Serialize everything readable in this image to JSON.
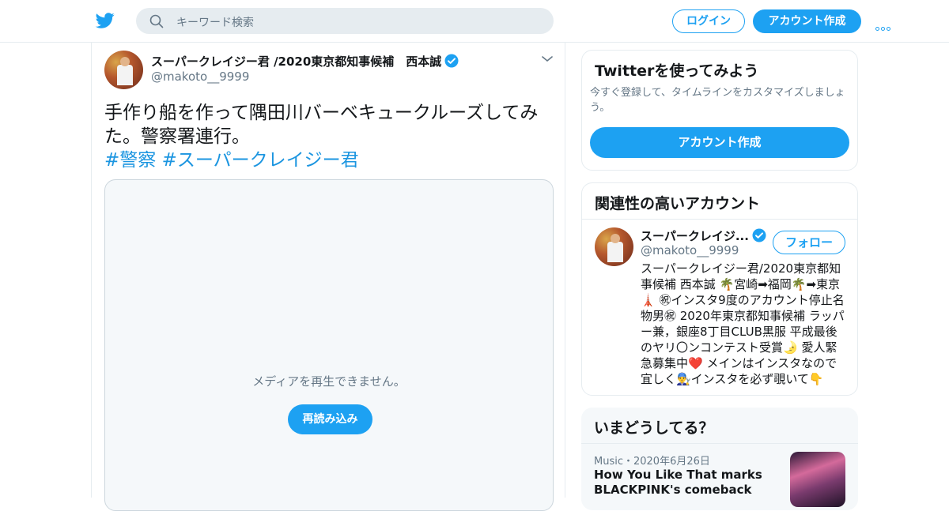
{
  "header": {
    "search_placeholder": "キーワード検索",
    "login_label": "ログイン",
    "signup_label": "アカウント作成"
  },
  "tweet": {
    "author_name": "スーパークレイジー君 /2020東京都知事候補　西本誠",
    "handle": "@makoto__9999",
    "text": "手作り船を作って隅田川バーベキュークルーズしてみた。警察署連行。",
    "hashtags": "#警察 #スーパークレイジー君",
    "media_message": "メディアを再生できません。",
    "reload_label": "再読み込み"
  },
  "signup_card": {
    "title": "Twitterを使ってみよう",
    "description": "今すぐ登録して、タイムラインをカスタマイズしましょう。",
    "button_label": "アカウント作成"
  },
  "related": {
    "title": "関連性の高いアカウント",
    "account_name": "スーパークレイジ...",
    "handle": "@makoto__9999",
    "follow_label": "フォロー",
    "bio": "スーパークレイジー君/2020東京都知事候補 西本誠 🌴宮崎➡福岡🌴➡東京🗼 ㊗インスタ9度のアカウント停止名物男㊗ 2020年東京都知事候補 ラッパー兼，銀座8丁目CLUB黒服 平成最後のヤリ〇ンコンテスト受賞🌛 愛人緊急募集中❤️ メインはインスタなので宜しく👨‍🔧インスタを必ず覗いて👇"
  },
  "trends": {
    "title": "いまどうしてる？",
    "item_meta": "Music・2020年6月26日",
    "item_title": "How You Like That marks BLACKPINK's comeback"
  },
  "colors": {
    "accent": "#1da1f2",
    "hashtag": "#1b95e0",
    "text": "#14171a",
    "muted": "#657786",
    "border": "#e6ecf0"
  }
}
